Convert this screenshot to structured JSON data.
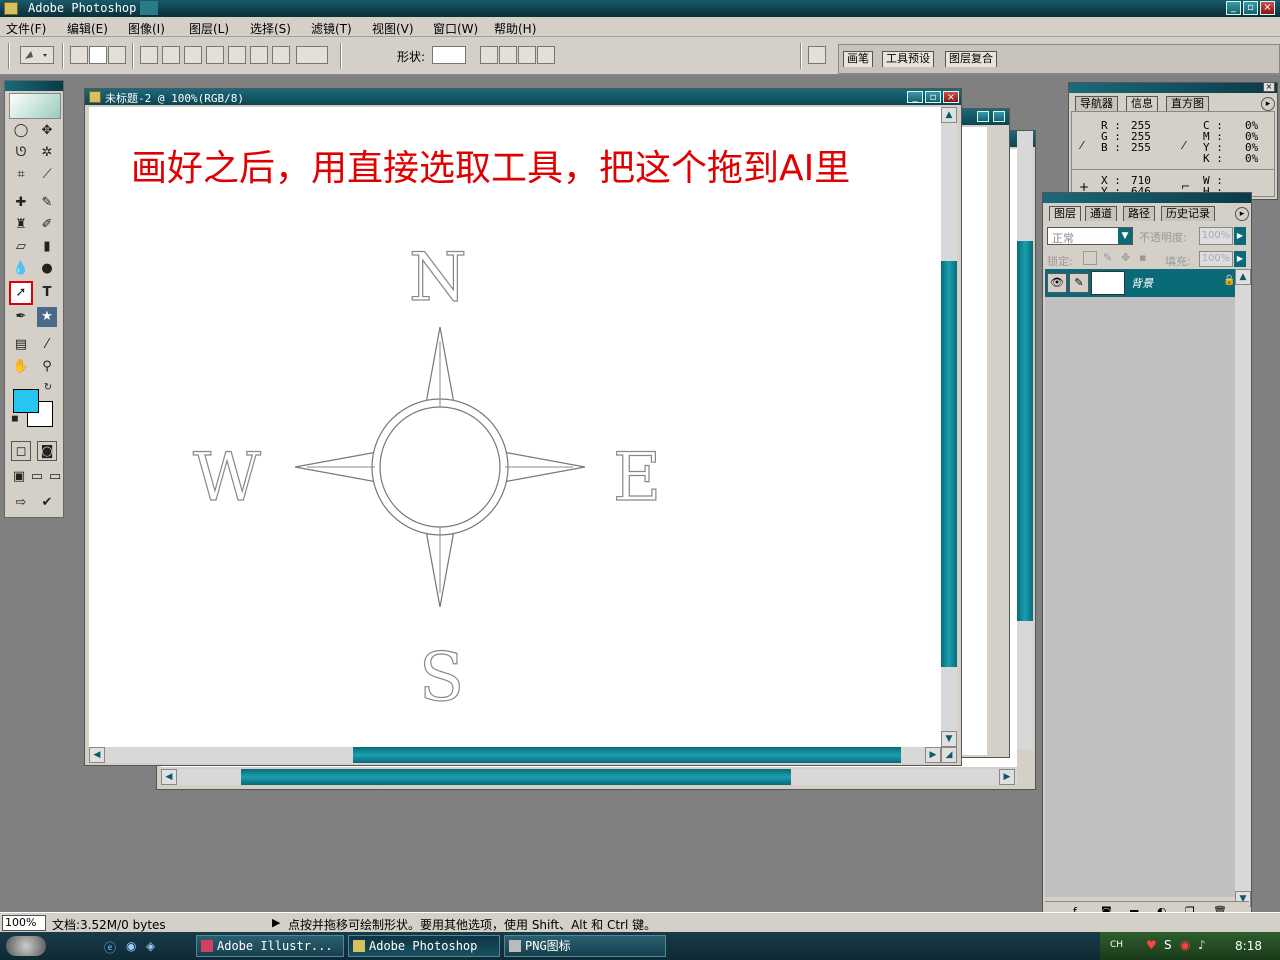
{
  "app": {
    "title": "Adobe Photoshop"
  },
  "menu": [
    "文件(F)",
    "编辑(E)",
    "图像(I)",
    "图层(L)",
    "选择(S)",
    "滤镜(T)",
    "视图(V)",
    "窗口(W)",
    "帮助(H)"
  ],
  "options": {
    "shape_label": "形状:",
    "palette_tabs": [
      "画笔",
      "工具预设",
      "图层复合"
    ]
  },
  "document": {
    "title": "未标题-2 @ 100%(RGB/8)",
    "annotation": "画好之后，用直接选取工具，把这个拖到AI里",
    "compass": {
      "north": "N",
      "south": "S",
      "east": "E",
      "west": "W"
    }
  },
  "info_palette": {
    "tabs": [
      "导航器",
      "信息",
      "直方图"
    ],
    "rgb": {
      "r_label": "R :",
      "r": "255",
      "g_label": "G :",
      "g": "255",
      "b_label": "B :",
      "b": "255"
    },
    "cmyk": {
      "c_label": "C :",
      "c": "0%",
      "m_label": "M :",
      "m": "0%",
      "y_label": "Y :",
      "y": "0%",
      "k_label": "K :",
      "k": "0%"
    },
    "position": {
      "x_label": "X :",
      "x": "710",
      "y_label": "Y :",
      "y": "646"
    },
    "size": {
      "w_label": "W :",
      "w": "",
      "h_label": "H :",
      "h": ""
    }
  },
  "layers_palette": {
    "tabs": [
      "图层",
      "通道",
      "路径",
      "历史记录"
    ],
    "blend_mode": "正常",
    "opacity_label": "不透明度:",
    "opacity": "100%",
    "lock_label": "锁定:",
    "fill_label": "填充:",
    "fill": "100%",
    "layers": [
      {
        "name": "背景"
      }
    ]
  },
  "status": {
    "zoom": "100%",
    "doc_info": "文档:3.52M/0 bytes",
    "hint": "点按并拖移可绘制形状。要用其他选项，使用 Shift、Alt 和 Ctrl 键。"
  },
  "taskbar": {
    "buttons": [
      "Adobe Illustr...",
      "Adobe Photoshop",
      "PNG图标"
    ],
    "tray_lang": "CH",
    "clock": "8:18"
  },
  "colors": {
    "foreground": "#25c6f0",
    "background": "#ffffff",
    "annotation": "#e00000",
    "accent": "#0a6a78"
  }
}
